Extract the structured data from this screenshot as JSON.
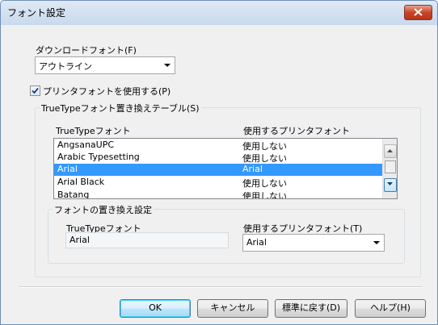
{
  "window": {
    "title": "フォント設定"
  },
  "download_font": {
    "label": "ダウンロードフォント(F)",
    "selected": "アウトライン"
  },
  "use_printer_font": {
    "label": "プリンタフォントを使用する(P)",
    "checked": true
  },
  "table_group": {
    "title": "TrueTypeフォント置き換えテーブル(S)",
    "columns": [
      "TrueTypeフォント",
      "使用するプリンタフォント"
    ],
    "rows": [
      {
        "truetype": "AngsanaUPC",
        "printer": "使用しない"
      },
      {
        "truetype": "Arabic Typesetting",
        "printer": "使用しない"
      },
      {
        "truetype": "Arial",
        "printer": "Arial",
        "selected": true
      },
      {
        "truetype": "Arial Black",
        "printer": "使用しない"
      },
      {
        "truetype": "Batang",
        "printer": "使用しない"
      }
    ]
  },
  "replace_settings": {
    "title": "フォントの置き換え設定",
    "truetype_label": "TrueTypeフォント",
    "truetype_value": "Arial",
    "printer_label": "使用するプリンタフォント(T)",
    "printer_value": "Arial"
  },
  "buttons": {
    "ok": "OK",
    "cancel": "キャンセル",
    "defaults": "標準に戻す(D)",
    "help": "ヘルプ(H)"
  },
  "colors": {
    "selection": "#3399ff",
    "close_button": "#c9452a"
  }
}
